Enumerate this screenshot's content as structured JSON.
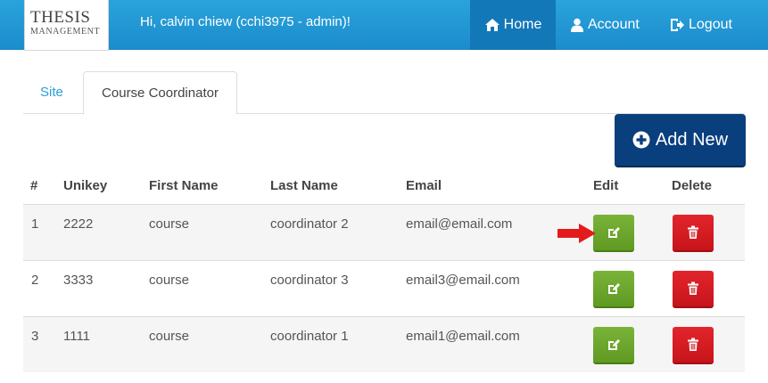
{
  "logo": {
    "title": "THESIS",
    "subtitle": "MANAGEMENT"
  },
  "header": {
    "greeting": "Hi, calvin chiew (cchi3975 - admin)!"
  },
  "nav": {
    "home": "Home",
    "account": "Account",
    "logout": "Logout"
  },
  "tabs": [
    {
      "label": "Site"
    },
    {
      "label": "Course Coordinator"
    }
  ],
  "actions": {
    "add_new": "Add New"
  },
  "table": {
    "columns": [
      "#",
      "Unikey",
      "First Name",
      "Last Name",
      "Email",
      "Edit",
      "Delete"
    ],
    "rows": [
      {
        "num": "1",
        "unikey": "2222",
        "first": "course",
        "last": "coordinator 2",
        "email": "email@email.com"
      },
      {
        "num": "2",
        "unikey": "3333",
        "first": "course",
        "last": "coordinator 3",
        "email": "email3@email.com"
      },
      {
        "num": "3",
        "unikey": "1111",
        "first": "course",
        "last": "coordinator 1",
        "email": "email1@email.com"
      }
    ]
  },
  "colors": {
    "navbar": "#2aa3dc",
    "nav_active": "#1378b8",
    "add_button": "#0a3f7e",
    "edit_button": "#6ca82d",
    "delete_button": "#d71c23",
    "tab_link": "#2a9fd6",
    "annotation_arrow": "#e31b1b"
  },
  "icons": {
    "home": "home-icon",
    "account": "user-icon",
    "logout": "logout-icon",
    "add": "plus-circle-icon",
    "edit": "edit-icon",
    "delete": "trash-icon"
  }
}
